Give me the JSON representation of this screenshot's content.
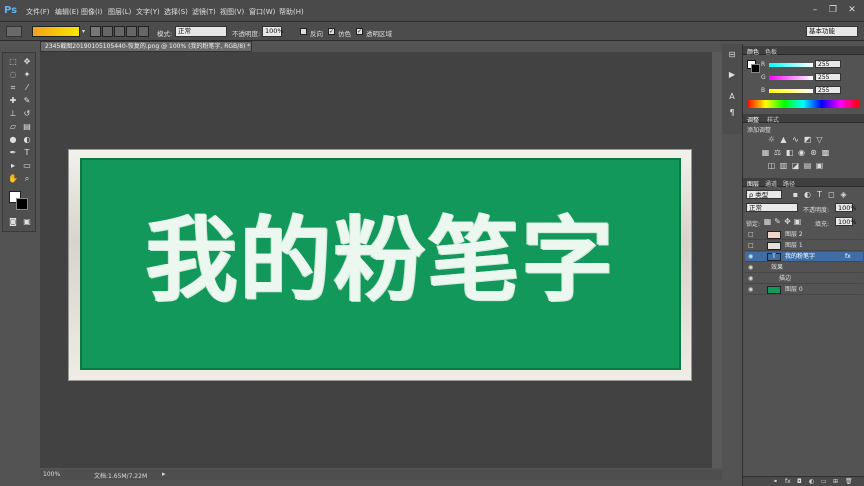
{
  "app": {
    "logo": "Ps"
  },
  "menu": [
    "文件(F)",
    "编辑(E)",
    "图像(I)",
    "图层(L)",
    "文字(Y)",
    "选择(S)",
    "滤镜(T)",
    "视图(V)",
    "窗口(W)",
    "帮助(H)"
  ],
  "window_controls": {
    "minimize": "–",
    "restore": "❐",
    "close": "✕"
  },
  "options_bar": {
    "mode_label": "模式:",
    "mode_value": "正常",
    "opacity_label": "不透明度:",
    "opacity_value": "100%",
    "reverse_label": "反向",
    "dither_label": "仿色",
    "transparency_label": "透明区域",
    "workspace": "基本功能"
  },
  "document": {
    "tab_title": "2345截图20190105105440-恢复的.png @ 100% (我的粉笔字, RGB/8) *",
    "tab_close": "×",
    "chalk_text": "我的粉笔字"
  },
  "status_bar": {
    "zoom": "100%",
    "doc_info": "文档:1.65M/7.22M"
  },
  "color_panel": {
    "tabs": [
      "颜色",
      "色板"
    ],
    "channels": [
      {
        "label": "R",
        "value": "255"
      },
      {
        "label": "G",
        "value": "255"
      },
      {
        "label": "B",
        "value": "255"
      }
    ]
  },
  "adjust_panel": {
    "tabs": [
      "调整",
      "样式"
    ],
    "heading": "添加调整"
  },
  "layers_panel": {
    "tabs": [
      "图层",
      "通道",
      "路径"
    ],
    "filter_label": "ρ 类型",
    "blend_mode": "正常",
    "opacity_label": "不透明度:",
    "opacity_value": "100%",
    "lock_label": "锁定:",
    "fill_label": "填充:",
    "fill_value": "100%",
    "layers": [
      {
        "name": "图层 2",
        "visible": false
      },
      {
        "name": "图层 1",
        "visible": false
      },
      {
        "name": "我的粉笔字",
        "visible": true,
        "fx": "fx"
      },
      {
        "name": "效果",
        "visible": true,
        "sub": true
      },
      {
        "name": "描边",
        "visible": true,
        "sub": true
      },
      {
        "name": "图层 0",
        "visible": true
      }
    ]
  },
  "colors": {
    "board_green": "#12985a",
    "selection_blue": "#3f6ea6",
    "accent_orange": "#f3a21b"
  }
}
